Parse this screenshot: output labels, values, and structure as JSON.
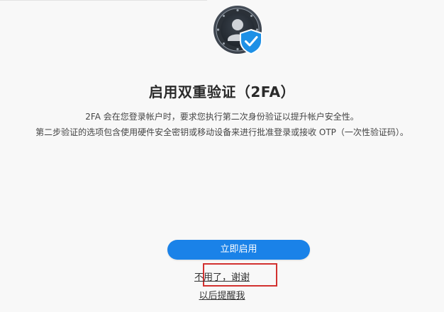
{
  "header": {
    "icon": "user-shield-check-icon"
  },
  "dialog": {
    "title": "启用双重验证（2FA）",
    "description_line1": "2FA 会在您登录帐户时，要求您执行第二次身份验证以提升帐户安全性。",
    "description_line2": "第二步验证的选项包含使用硬件安全密钥或移动设备来进行批准登录或接收 OTP（一次性验证码）。",
    "enable_now_label": "立即启用",
    "no_thanks_label": "不用了，谢谢",
    "remind_later_label": "以后提醒我"
  },
  "colors": {
    "primary": "#1a82e8",
    "shield": "#1e90e6",
    "highlight": "#d2312f",
    "background": "#f8f8f8"
  }
}
